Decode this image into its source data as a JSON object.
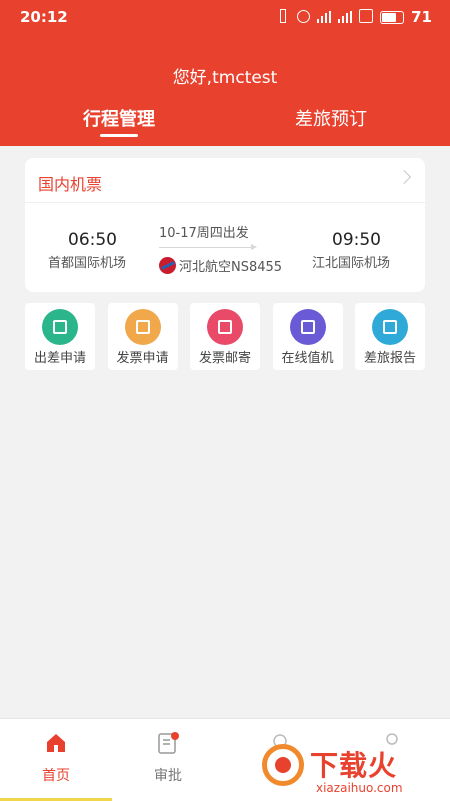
{
  "status_bar": {
    "time": "20:12",
    "battery": "71"
  },
  "header": {
    "greeting": "您好,tmctest",
    "tabs": [
      {
        "label": "行程管理",
        "active": true
      },
      {
        "label": "差旅预订",
        "active": false
      }
    ]
  },
  "trip_card": {
    "title": "国内机票",
    "departure_time": "06:50",
    "departure_airport": "首都国际机场",
    "date_info": "10-17周四出发",
    "airline_flight": "河北航空NS8455",
    "arrival_time": "09:50",
    "arrival_airport": "江北国际机场"
  },
  "services": [
    {
      "label": "出差申请",
      "icon": "briefcase-icon",
      "color": "#2bb58a"
    },
    {
      "label": "发票申请",
      "icon": "ticket-icon",
      "color": "#f0a84b"
    },
    {
      "label": "发票邮寄",
      "icon": "mail-icon",
      "color": "#e94a67"
    },
    {
      "label": "在线值机",
      "icon": "seat-icon",
      "color": "#6a5ad6"
    },
    {
      "label": "差旅报告",
      "icon": "report-icon",
      "color": "#2fa9d8"
    }
  ],
  "bottom_nav": [
    {
      "label": "首页",
      "icon": "home-icon",
      "active": true
    },
    {
      "label": "审批",
      "icon": "approval-icon",
      "active": false
    }
  ],
  "watermark": {
    "text": "下载火",
    "url": "xiazaihuo.com"
  },
  "colors": {
    "brand": "#e8422f"
  }
}
